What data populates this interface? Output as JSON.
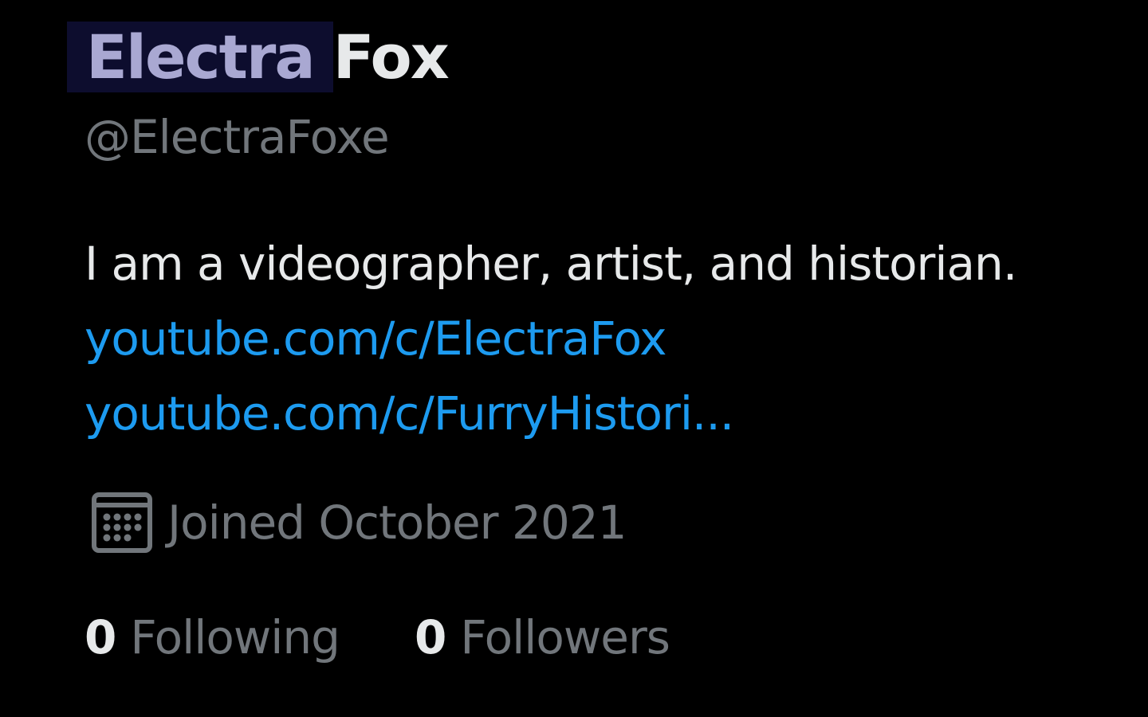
{
  "profile": {
    "first_name": "Electra",
    "last_name": "Fox",
    "handle": "@ElectraFoxe",
    "bio": "I am a videographer, artist, and historian.",
    "links": [
      "youtube.com/c/ElectraFox",
      "youtube.com/c/FurryHistori..."
    ],
    "joined": "Joined October 2021",
    "following_count": "0",
    "following_label": "Following",
    "followers_count": "0",
    "followers_label": "Followers"
  },
  "icons": {
    "joined": "calendar-icon"
  },
  "colors": {
    "background": "#000000",
    "primary_text": "#e7e9ea",
    "secondary_text": "#71767b",
    "link": "#1d9bf0",
    "name_highlight_bg": "#0d0d2e",
    "name_highlight_text": "#a9a8d2"
  }
}
